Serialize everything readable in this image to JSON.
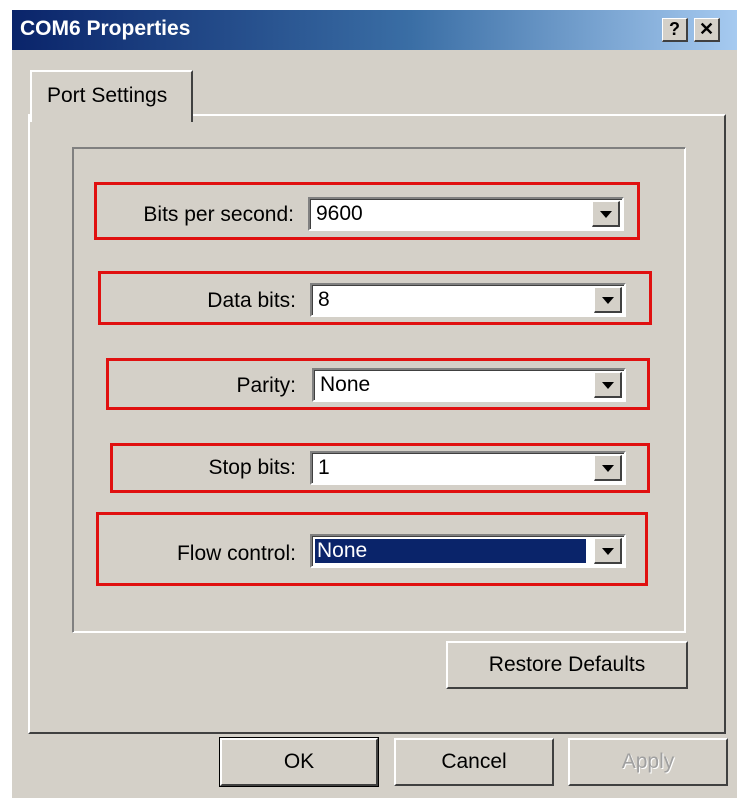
{
  "window": {
    "title": "COM6 Properties",
    "help_label": "?",
    "close_label": "✕"
  },
  "tabs": [
    {
      "label": "Port Settings",
      "active": true
    }
  ],
  "fields": {
    "bits_per_second": {
      "label": "Bits per second:",
      "value": "9600"
    },
    "data_bits": {
      "label": "Data bits:",
      "value": "8"
    },
    "parity": {
      "label": "Parity:",
      "value": "None"
    },
    "stop_bits": {
      "label": "Stop bits:",
      "value": "1"
    },
    "flow_control": {
      "label": "Flow control:",
      "value": "None",
      "selected": true
    }
  },
  "buttons": {
    "restore_defaults": "Restore Defaults",
    "ok": "OK",
    "cancel": "Cancel",
    "apply": "Apply"
  },
  "colors": {
    "highlight_box": "#e01010",
    "selection": "#0a246a",
    "dialog_face": "#d4d0c8"
  }
}
